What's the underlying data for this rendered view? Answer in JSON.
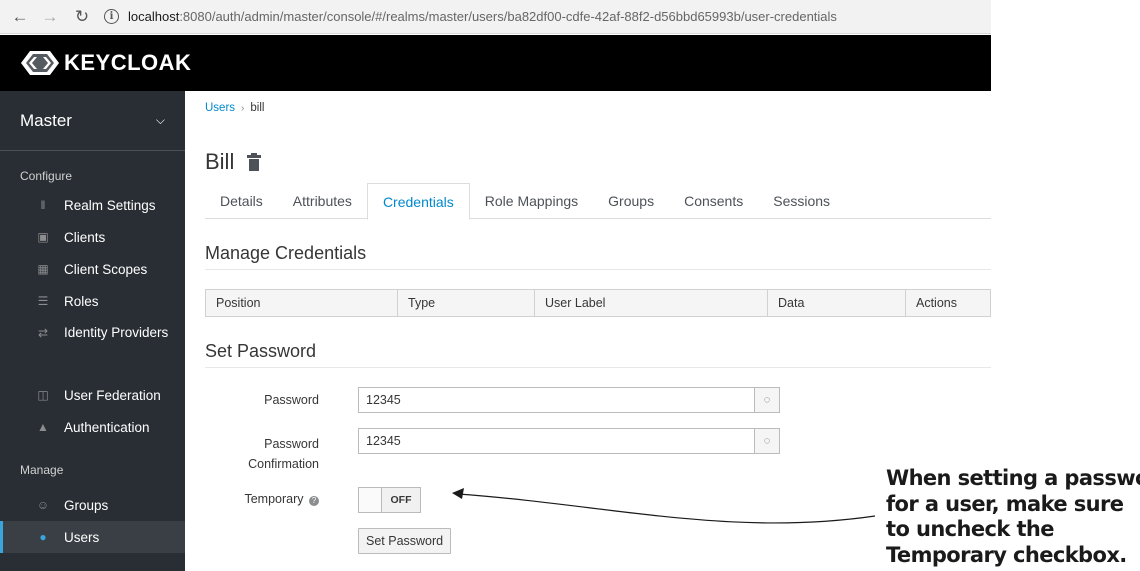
{
  "browser": {
    "url_host": "localhost",
    "url_rest": ":8080/auth/admin/master/console/#/realms/master/users/ba82df00-cdfe-42af-88f2-d56bbd65993b/user-credentials"
  },
  "header": {
    "brand": "KEYCLOAK"
  },
  "sidebar": {
    "realm": "Master",
    "configure_heading": "Configure",
    "configure_items": [
      {
        "label": "Realm Settings",
        "icon": "sliders-icon"
      },
      {
        "label": "Clients",
        "icon": "cube-icon"
      },
      {
        "label": "Client Scopes",
        "icon": "cubes-icon"
      },
      {
        "label": "Roles",
        "icon": "list-icon"
      },
      {
        "label": "Identity Providers",
        "icon": "exchange-icon"
      },
      {
        "label": "User Federation",
        "icon": "database-icon"
      },
      {
        "label": "Authentication",
        "icon": "lock-icon"
      }
    ],
    "manage_heading": "Manage",
    "manage_items": [
      {
        "label": "Groups",
        "icon": "users-icon"
      },
      {
        "label": "Users",
        "icon": "user-icon",
        "active": true
      }
    ]
  },
  "breadcrumb": {
    "parent": "Users",
    "current": "bill"
  },
  "user": {
    "name": "Bill"
  },
  "tabs": [
    "Details",
    "Attributes",
    "Credentials",
    "Role Mappings",
    "Groups",
    "Consents",
    "Sessions"
  ],
  "active_tab": "Credentials",
  "manage_credentials": {
    "title": "Manage Credentials",
    "columns": [
      "Position",
      "Type",
      "User Label",
      "Data",
      "Actions"
    ]
  },
  "set_password": {
    "title": "Set Password",
    "password_label": "Password",
    "password_value": "12345",
    "confirm_label_line1": "Password",
    "confirm_label_line2": "Confirmation",
    "confirm_value": "12345",
    "temporary_label": "Temporary",
    "temporary_state": "OFF",
    "button_label": "Set Password"
  },
  "annotation": {
    "lines": [
      "When setting a password",
      "for a user, make sure",
      "to uncheck the",
      "Temporary checkbox."
    ]
  },
  "colors": {
    "sidebar_bg": "#292e34",
    "header_bg": "#000000",
    "accent": "#0088ce",
    "active_indicator": "#39a5dc"
  }
}
